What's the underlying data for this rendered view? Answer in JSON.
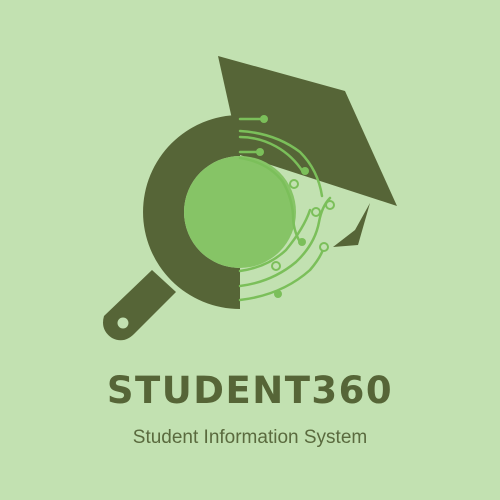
{
  "brand": {
    "name": "STUDENT360",
    "tagline": "Student Information System"
  },
  "logo": {
    "icon": "magnifier-graduation-cap-circuit-icon"
  },
  "colors": {
    "background": "#c2e1b1",
    "primary_dark": "#566537",
    "accent_green": "#86c466",
    "circuit_green": "#7bbf5a"
  }
}
